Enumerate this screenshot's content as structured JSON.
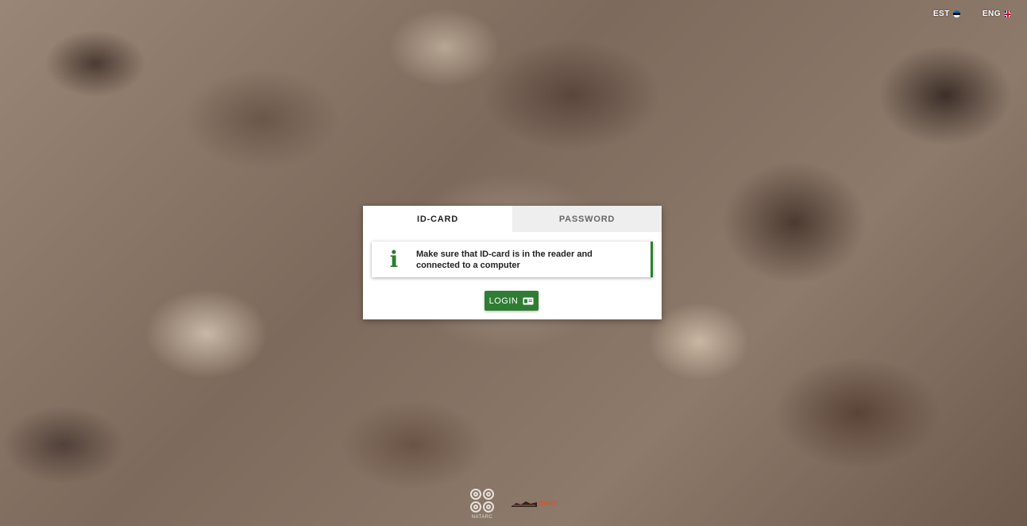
{
  "language_switcher": {
    "est_label": "EST",
    "eng_label": "ENG"
  },
  "login_card": {
    "tabs": [
      {
        "label": "ID-CARD",
        "active": true
      },
      {
        "label": "PASSWORD",
        "active": false
      }
    ],
    "alert": {
      "icon": "info-icon",
      "line1": "Make sure that ID-card is in the reader and",
      "line2": "connected to a computer"
    },
    "login_button_label": "LOGIN",
    "login_button_icon": "id-card-icon"
  },
  "footer": {
    "natarc_label": "NATARC",
    "sarv_label": "SARV"
  },
  "colors": {
    "accent_green": "#2e7d32",
    "sarv_orange": "#d8542a"
  }
}
